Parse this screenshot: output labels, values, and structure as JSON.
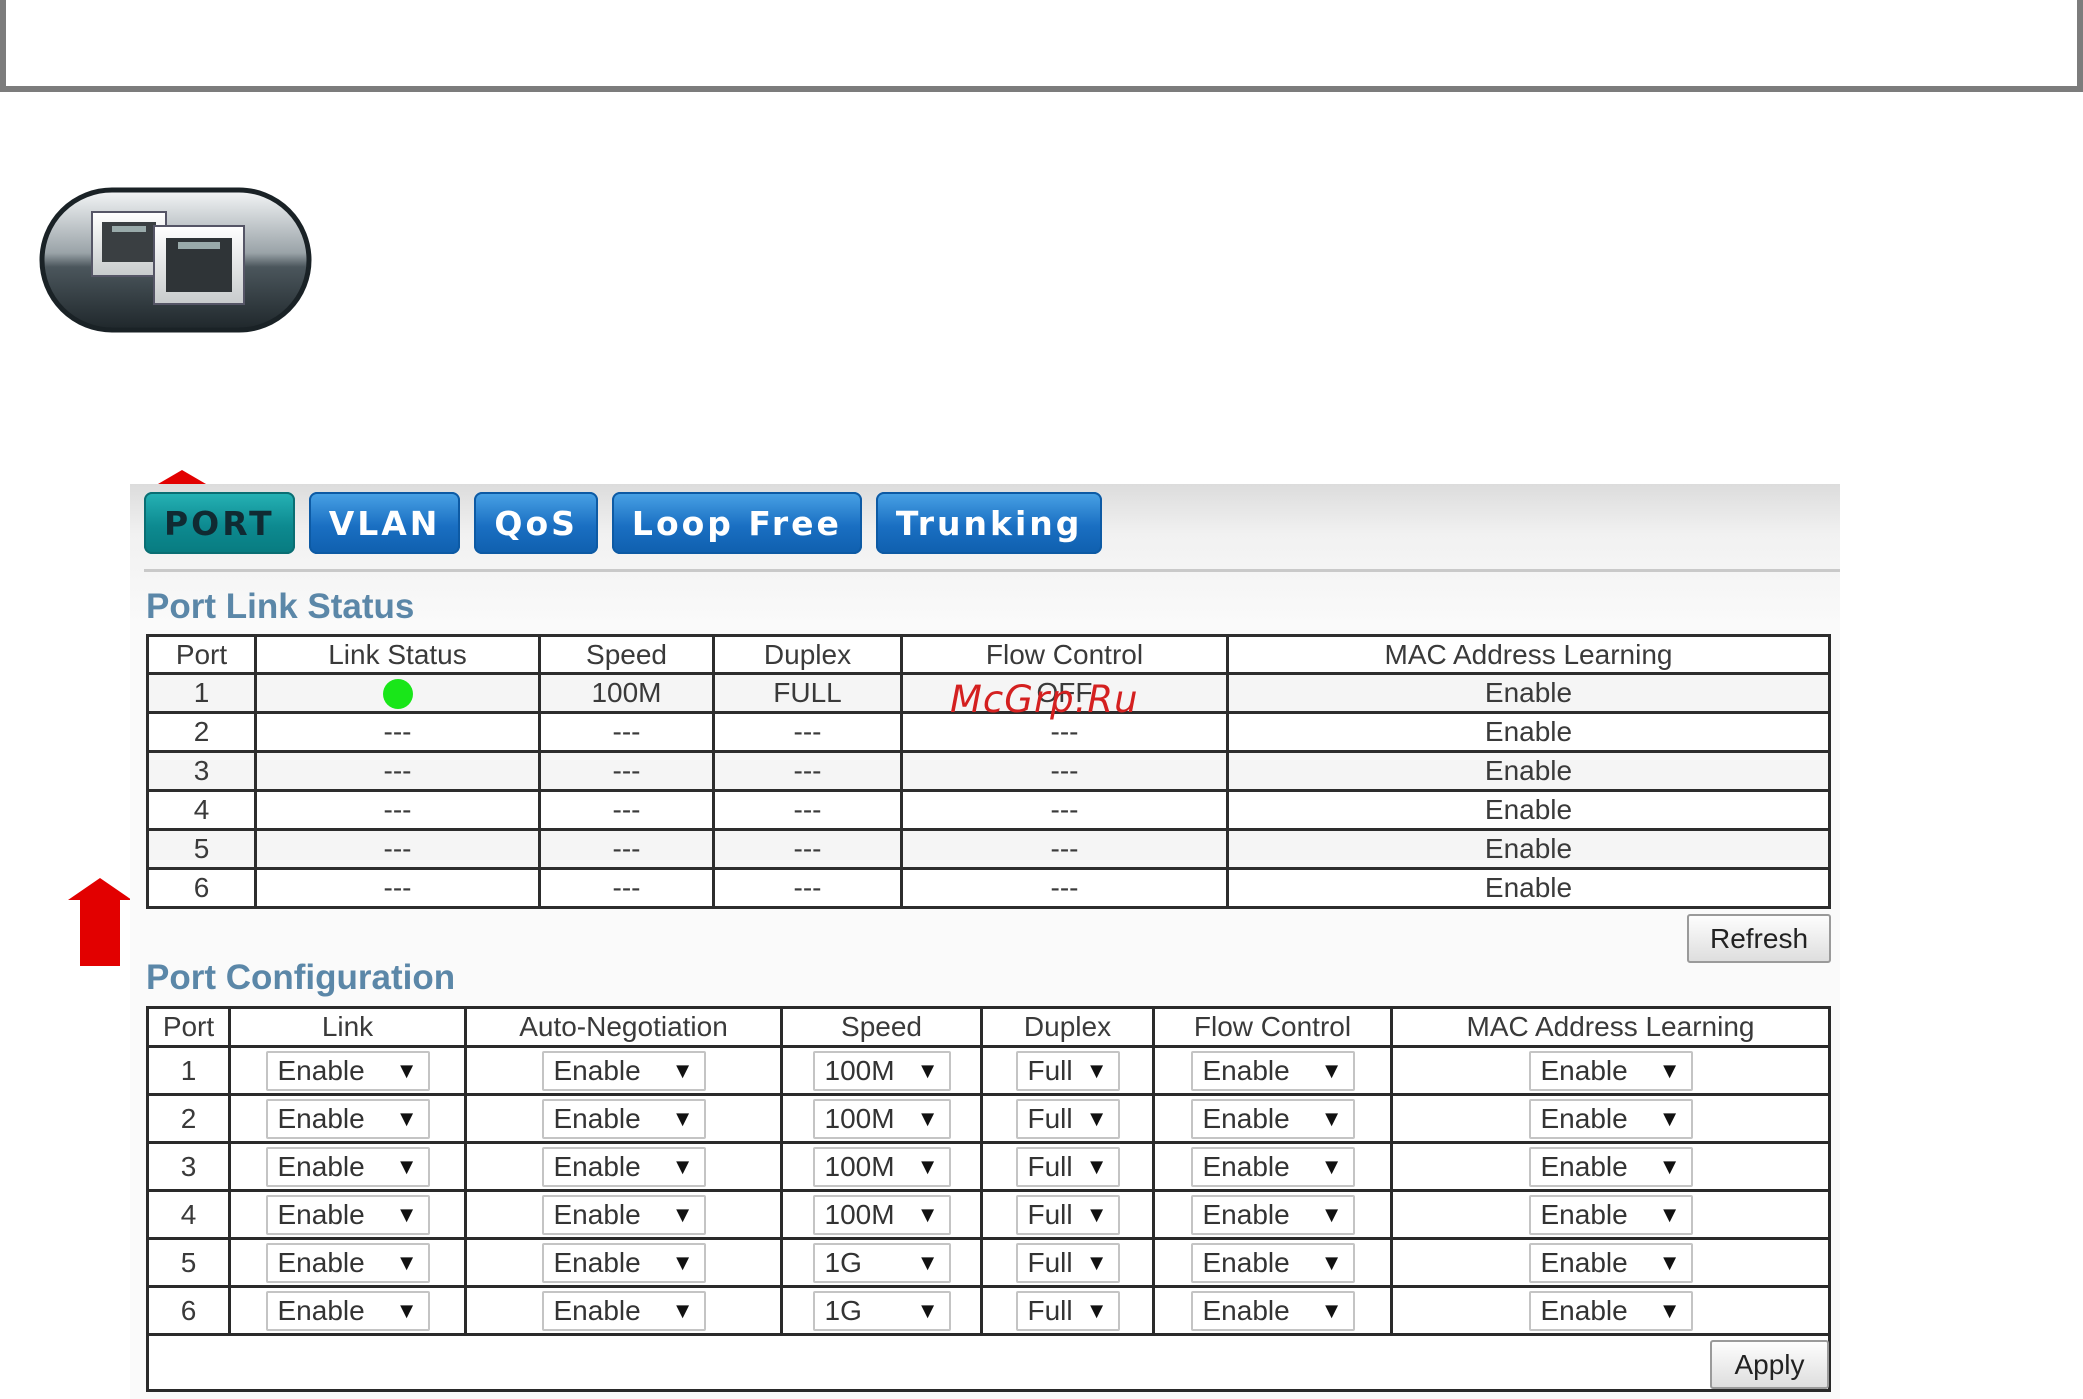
{
  "tabs": [
    {
      "label": "PORT",
      "active": true
    },
    {
      "label": "VLAN",
      "active": false
    },
    {
      "label": "QoS",
      "active": false
    },
    {
      "label": "Loop Free",
      "active": false
    },
    {
      "label": "Trunking",
      "active": false
    }
  ],
  "port_link_status": {
    "title": "Port Link Status",
    "headers": [
      "Port",
      "Link Status",
      "Speed",
      "Duplex",
      "Flow Control",
      "MAC Address Learning"
    ],
    "rows": [
      {
        "port": "1",
        "link": "up",
        "speed": "100M",
        "duplex": "FULL",
        "flow": "OFF",
        "mac": "Enable"
      },
      {
        "port": "2",
        "link": "---",
        "speed": "---",
        "duplex": "---",
        "flow": "---",
        "mac": "Enable"
      },
      {
        "port": "3",
        "link": "---",
        "speed": "---",
        "duplex": "---",
        "flow": "---",
        "mac": "Enable"
      },
      {
        "port": "4",
        "link": "---",
        "speed": "---",
        "duplex": "---",
        "flow": "---",
        "mac": "Enable"
      },
      {
        "port": "5",
        "link": "---",
        "speed": "---",
        "duplex": "---",
        "flow": "---",
        "mac": "Enable"
      },
      {
        "port": "6",
        "link": "---",
        "speed": "---",
        "duplex": "---",
        "flow": "---",
        "mac": "Enable"
      }
    ],
    "refresh_label": "Refresh",
    "link_up_color": "#19e619"
  },
  "port_configuration": {
    "title": "Port Configuration",
    "headers": [
      "Port",
      "Link",
      "Auto-Negotiation",
      "Speed",
      "Duplex",
      "Flow Control",
      "MAC Address Learning"
    ],
    "rows": [
      {
        "port": "1",
        "link": "Enable",
        "auto": "Enable",
        "speed": "100M",
        "duplex": "Full",
        "flow": "Enable",
        "mac": "Enable"
      },
      {
        "port": "2",
        "link": "Enable",
        "auto": "Enable",
        "speed": "100M",
        "duplex": "Full",
        "flow": "Enable",
        "mac": "Enable"
      },
      {
        "port": "3",
        "link": "Enable",
        "auto": "Enable",
        "speed": "100M",
        "duplex": "Full",
        "flow": "Enable",
        "mac": "Enable"
      },
      {
        "port": "4",
        "link": "Enable",
        "auto": "Enable",
        "speed": "100M",
        "duplex": "Full",
        "flow": "Enable",
        "mac": "Enable"
      },
      {
        "port": "5",
        "link": "Enable",
        "auto": "Enable",
        "speed": "1G",
        "duplex": "Full",
        "flow": "Enable",
        "mac": "Enable"
      },
      {
        "port": "6",
        "link": "Enable",
        "auto": "Enable",
        "speed": "1G",
        "duplex": "Full",
        "flow": "Enable",
        "mac": "Enable"
      }
    ],
    "apply_label": "Apply"
  },
  "dropdown_caret": "▼",
  "watermark": "McGrp.Ru",
  "colors": {
    "tab_blue": "#1a6fc2",
    "tab_active": "#0d8a90",
    "section_title": "#5b87a8",
    "arrow_red": "#e20000"
  },
  "icons": [
    "ethernet-ports-icon",
    "arrow-up-icon"
  ]
}
